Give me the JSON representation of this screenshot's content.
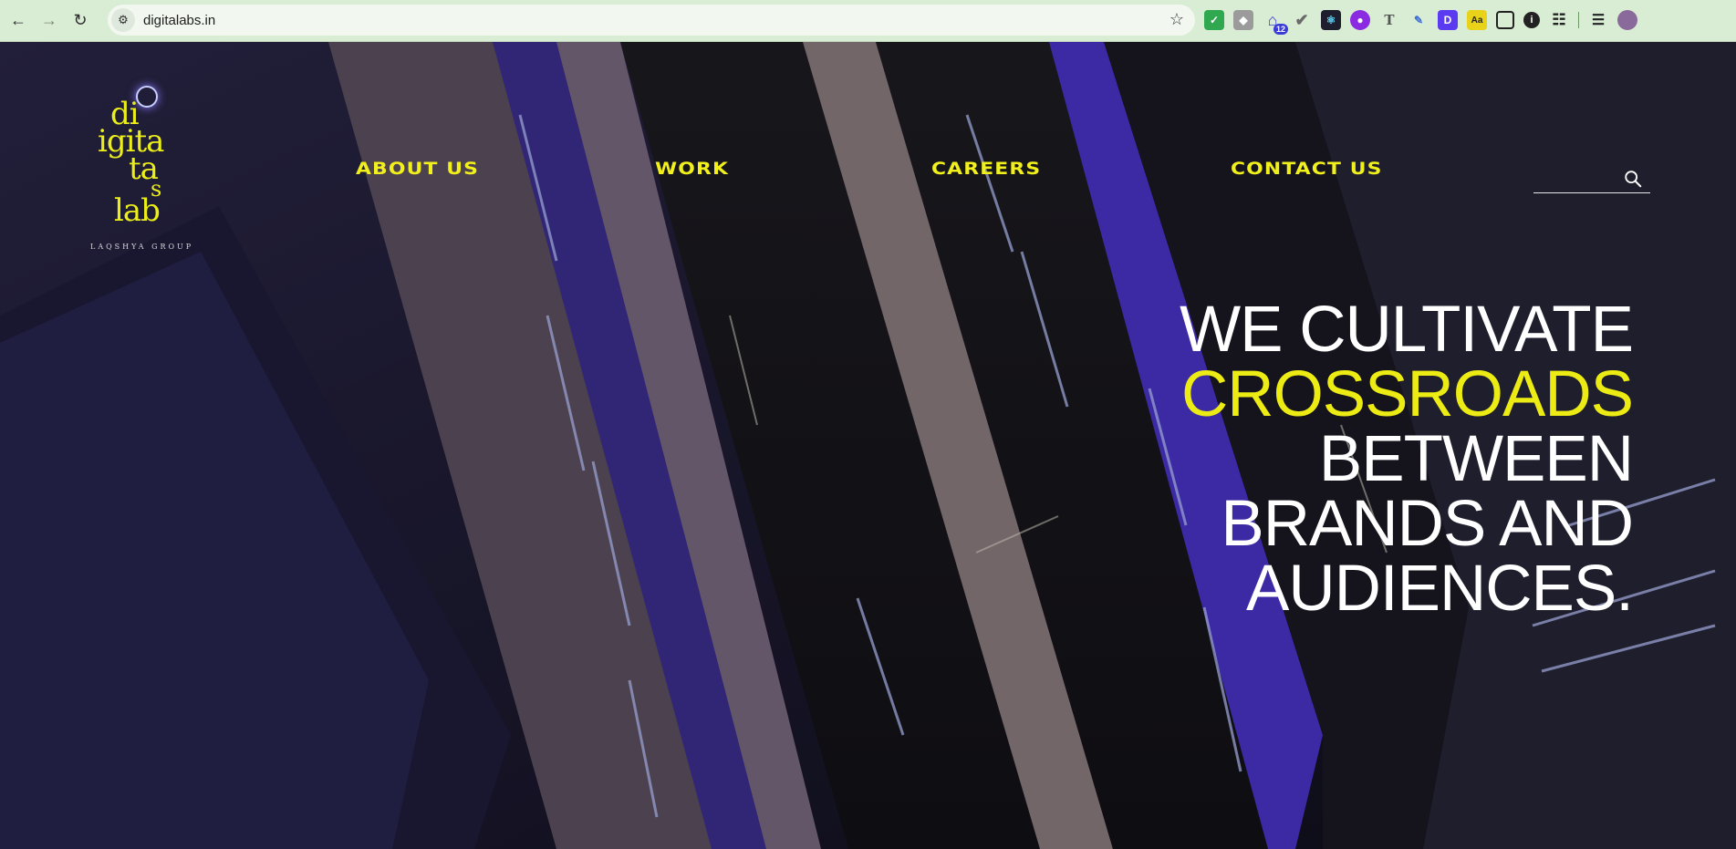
{
  "browser": {
    "url": "digitalabs.in",
    "extensions": [
      {
        "name": "shield-check-icon",
        "color": "#2fa84f"
      },
      {
        "name": "shield-icon",
        "color": "#8a8a8a"
      },
      {
        "name": "home-icon",
        "color": "#3b3bd6",
        "badge": "12"
      },
      {
        "name": "check-circle-icon",
        "color": "#6a6a6a"
      },
      {
        "name": "react-icon",
        "color": "#1e1e2e"
      },
      {
        "name": "circle-app-icon",
        "color": "#8a2be2"
      },
      {
        "name": "text-icon",
        "color": "#555555"
      },
      {
        "name": "pen-icon",
        "color": "#3b6ed6"
      },
      {
        "name": "d-icon",
        "color": "#5b3bf0"
      },
      {
        "name": "dictionary-icon",
        "color": "#e8d21a"
      },
      {
        "name": "image-icon",
        "color": "#222222"
      },
      {
        "name": "info-icon",
        "color": "#222222"
      },
      {
        "name": "puzzle-icon",
        "color": "#222222"
      },
      {
        "name": "media-icon",
        "color": "#222222"
      },
      {
        "name": "profile-avatar-icon",
        "color": "#8a6a9a"
      }
    ]
  },
  "logo": {
    "lines": [
      "di",
      "igita",
      "ta",
      "s",
      "lab"
    ],
    "subtitle": "LAQSHYA GROUP"
  },
  "nav": {
    "items": [
      {
        "label": "ABOUT US"
      },
      {
        "label": "WORK"
      },
      {
        "label": "CAREERS"
      },
      {
        "label": "CONTACT US"
      }
    ]
  },
  "search": {
    "placeholder": ""
  },
  "hero": {
    "line1": "WE CULTIVATE",
    "line2": "CROSSROADS",
    "line3": "BETWEEN",
    "line4": "BRANDS AND",
    "line5": "AUDIENCES.",
    "accent": "#ecec14"
  }
}
